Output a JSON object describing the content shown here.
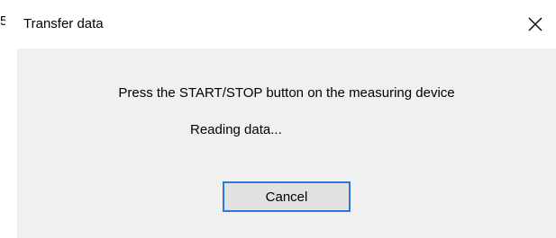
{
  "dialog": {
    "title": "Transfer data",
    "close_icon": "close-icon",
    "message": "Press the START/STOP button on the measuring device",
    "status": "Reading data...",
    "cancel_label": "Cancel"
  },
  "colors": {
    "titlebar_bg": "#ffffff",
    "body_bg": "#f0f0f0",
    "button_bg": "#e1e1e1",
    "button_focus_border": "#2b79d7"
  }
}
